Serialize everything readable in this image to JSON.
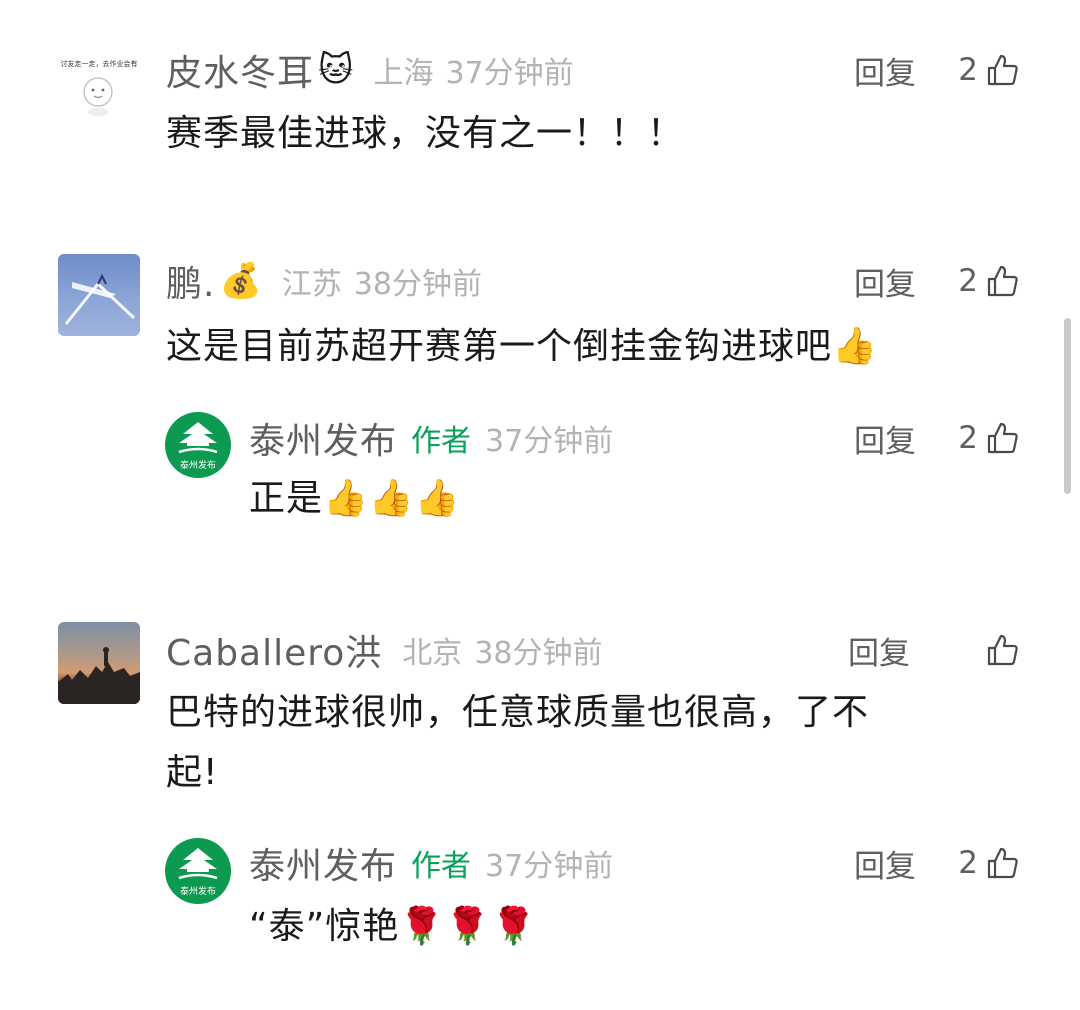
{
  "comments": [
    {
      "name": "皮水冬耳",
      "emoji": "🐱",
      "location": "上海",
      "time": "37分钟前",
      "reply_label": "回复",
      "likes": "2",
      "text": "赛季最佳进球，没有之一！！！",
      "avatar_caption": "讨友走一走，去作业会有"
    },
    {
      "name": "鹏.",
      "emoji": "💰",
      "location": "江苏",
      "time": "38分钟前",
      "reply_label": "回复",
      "likes": "2",
      "text": "这是目前苏超开赛第一个倒挂金钩进球吧👍",
      "reply": {
        "name": "泰州发布",
        "author_tag": "作者",
        "time": "37分钟前",
        "reply_label": "回复",
        "likes": "2",
        "text": "正是👍👍👍",
        "avatar_text": "泰州发布"
      }
    },
    {
      "name": "Caballero洪",
      "location": "北京",
      "time": "38分钟前",
      "reply_label": "回复",
      "likes": "",
      "text_line1": "巴特的进球很帅，任意球质量也很高，了不",
      "text_line2": "起!",
      "reply": {
        "name": "泰州发布",
        "author_tag": "作者",
        "time": "37分钟前",
        "reply_label": "回复",
        "likes": "2",
        "text": "“泰”惊艳🌹🌹🌹",
        "avatar_text": "泰州发布"
      }
    }
  ],
  "colors": {
    "author_green": "#07a15a",
    "meta_gray": "#b3b3b3",
    "name_gray": "#5f5f5f"
  }
}
